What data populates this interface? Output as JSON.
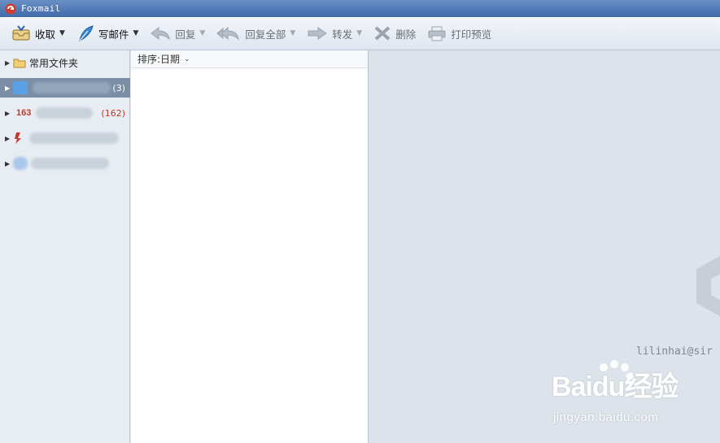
{
  "window": {
    "title": "Foxmail"
  },
  "toolbar": {
    "receive": "收取",
    "compose": "写邮件",
    "reply": "回复",
    "reply_all": "回复全部",
    "forward": "转发",
    "delete": "删除",
    "print_preview": "打印预览"
  },
  "folders": {
    "common": "常用文件夹",
    "accounts": [
      {
        "badge": "",
        "count": "(3)"
      },
      {
        "badge": "163",
        "count": "(162)"
      },
      {
        "badge": "",
        "count": ""
      },
      {
        "badge": "",
        "count": ""
      }
    ]
  },
  "list": {
    "sort_label": "排序:日期"
  },
  "reader": {
    "account_hint": "lilinhai@sir"
  },
  "watermark": {
    "brand": "Baidu经验",
    "url": "jingyan.baidu.com"
  },
  "colors": {
    "accent": "#3f6bab",
    "selected": "#7a8ea6",
    "count": "#c0392b"
  }
}
